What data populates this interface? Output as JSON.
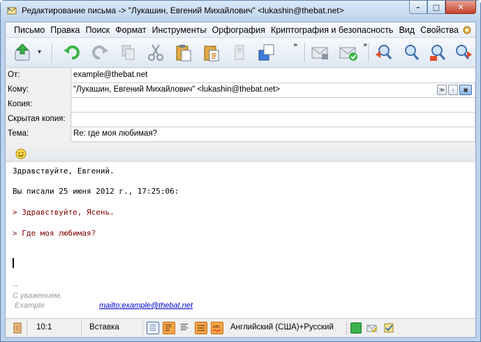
{
  "window": {
    "title": "Редактирование письма -> \"Лукашин, Евгений Михайлович\" <lukashin@thebat.net>",
    "controls": {
      "minimize": "–",
      "maximize": "□",
      "close": "✕"
    }
  },
  "menu": {
    "items": [
      "Письмо",
      "Правка",
      "Поиск",
      "Формат",
      "Инструменты",
      "Орфография",
      "Криптография и безопасность",
      "Вид",
      "Свойства"
    ]
  },
  "toolbar": {
    "overflow_left": "»",
    "overflow_right": "»"
  },
  "header": {
    "from_label": "От:",
    "from_value": "example@thebat.net",
    "to_label": "Кому:",
    "to_value": "\"Лукашин, Евгений Михайлович\" <lukashin@thebat.net>",
    "cc_label": "Копия:",
    "cc_value": "",
    "bcc_label": "Скрытая копия:",
    "bcc_value": "",
    "subject_label": "Тема:",
    "subject_value": "Re: где моя любимая?"
  },
  "body": {
    "greeting": "Здравствуйте, Евгений.",
    "wrote": "Вы писали 25 июня 2012 г., 17:25:06:",
    "quote1": "> Здравствуйте, Ясень.",
    "quote2": "> Где моя любимая?",
    "sig_dashes": "--",
    "sig_regards": "С уважением,",
    "sig_name": " Example",
    "sig_link": "mailto:example@thebat.net"
  },
  "status": {
    "position": "10:1",
    "mode": "Вставка",
    "language": "Английский (США)+Русский"
  },
  "colors": {
    "accent": "#3f6fab",
    "quote": "#800000",
    "link": "#0000cc",
    "status_active": "#f6a54a"
  }
}
